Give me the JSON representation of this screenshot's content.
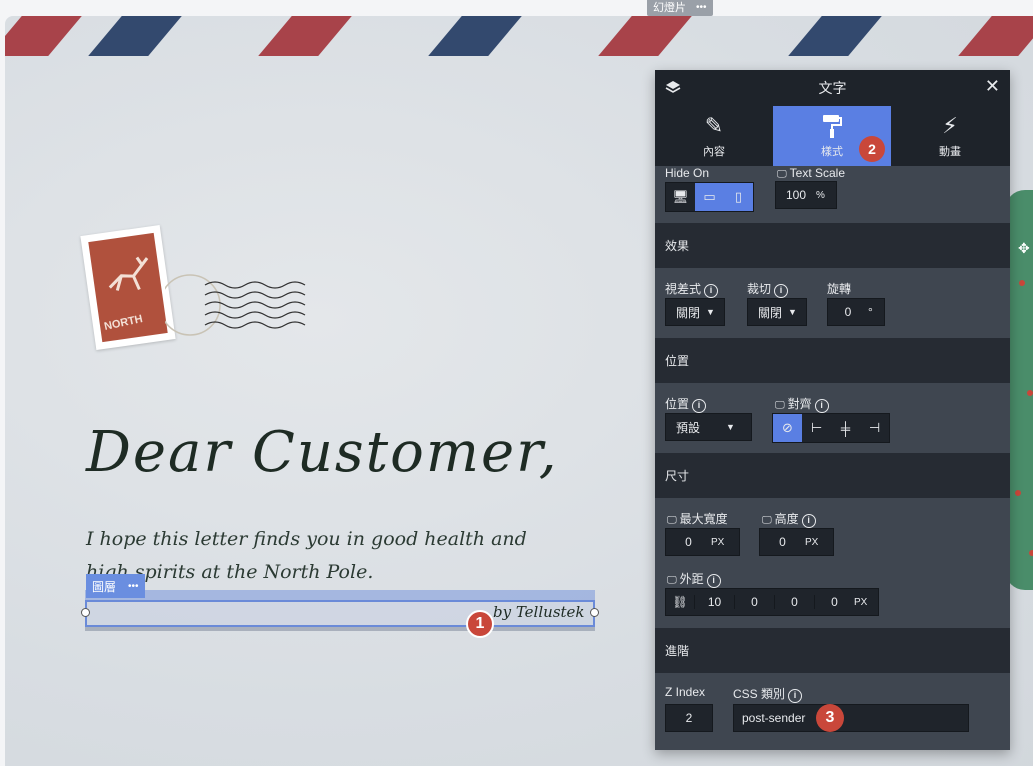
{
  "slide": {
    "tag_label": "幻燈片",
    "more": "•••"
  },
  "stamp": {
    "text": "NORTH"
  },
  "letter": {
    "greeting": "Dear Customer,",
    "line1": "I hope this letter finds you in good health and",
    "line2": "high spirits at the North Pole.",
    "sender": "by Tellustek"
  },
  "layer": {
    "tag_label": "圖層",
    "more": "•••"
  },
  "badges": {
    "b1": "1",
    "b2": "2",
    "b3": "3"
  },
  "panel": {
    "title": "文字",
    "close": "✕",
    "tabs": [
      {
        "label": "內容",
        "icon": "pencil-icon",
        "glyph": "✎"
      },
      {
        "label": "樣式",
        "icon": "paint-roller-icon",
        "glyph": "🖌"
      },
      {
        "label": "動畫",
        "icon": "lightning-icon",
        "glyph": "⚡"
      }
    ],
    "hide_on": {
      "label": "Hide On"
    },
    "text_scale": {
      "label": "Text Scale",
      "value": "100",
      "unit": "%"
    },
    "effects": {
      "heading": "效果",
      "parallax": {
        "label": "視差式",
        "value": "關閉"
      },
      "crop": {
        "label": "裁切",
        "value": "關閉"
      },
      "rotate": {
        "label": "旋轉",
        "value": "0",
        "unit": "°"
      }
    },
    "position": {
      "heading": "位置",
      "pos": {
        "label": "位置",
        "value": "預設"
      },
      "align": {
        "label": "對齊"
      }
    },
    "size": {
      "heading": "尺寸",
      "max_width": {
        "label": "最大寬度",
        "value": "0",
        "unit": "PX"
      },
      "height": {
        "label": "高度",
        "value": "0",
        "unit": "PX"
      },
      "margin": {
        "label": "外距",
        "values": [
          "10",
          "0",
          "0",
          "0"
        ],
        "unit": "PX"
      }
    },
    "advanced": {
      "heading": "進階",
      "zindex": {
        "label": "Z Index",
        "value": "2"
      },
      "css": {
        "label": "CSS 類別",
        "value": "post-sender"
      }
    }
  },
  "colors": {
    "accent": "#5a7fe3",
    "badge": "#c9473a",
    "stripe_red": "#a8434a",
    "stripe_blue": "#33496e"
  }
}
